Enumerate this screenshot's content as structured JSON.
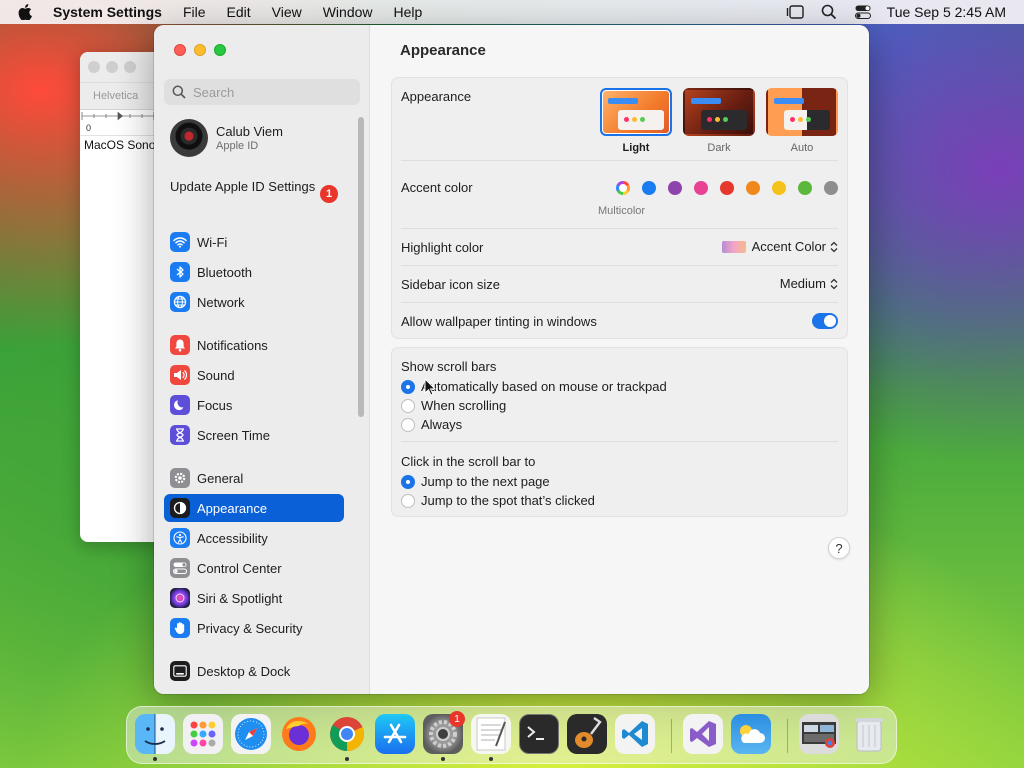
{
  "menubar": {
    "app_name": "System Settings",
    "menus": [
      "File",
      "Edit",
      "View",
      "Window",
      "Help"
    ],
    "clock": "Tue Sep 5  2:45 AM"
  },
  "background_window": {
    "font_name": "Helvetica",
    "ruler_zero": "0",
    "doc_text": "MacOS Sonoma"
  },
  "sidebar": {
    "search_placeholder": "Search",
    "account": {
      "name": "Calub Viem",
      "subtitle": "Apple ID"
    },
    "update": {
      "label": "Update Apple ID Settings",
      "badge": "1"
    },
    "items": [
      {
        "label": "Wi-Fi",
        "icon": "wifi-icon",
        "color": "#1b7cf2"
      },
      {
        "label": "Bluetooth",
        "icon": "bluetooth-icon",
        "color": "#1b7cf2"
      },
      {
        "label": "Network",
        "icon": "globe-icon",
        "color": "#1b7cf2"
      },
      {
        "label": "Notifications",
        "icon": "bell-icon",
        "color": "#f0483e"
      },
      {
        "label": "Sound",
        "icon": "speaker-icon",
        "color": "#f0483e"
      },
      {
        "label": "Focus",
        "icon": "moon-icon",
        "color": "#5d4fd8"
      },
      {
        "label": "Screen Time",
        "icon": "hourglass-icon",
        "color": "#5d4fd8"
      },
      {
        "label": "General",
        "icon": "gear-icon",
        "color": "#8e8e93"
      },
      {
        "label": "Appearance",
        "icon": "appearance-icon",
        "color": "#1d1d1f"
      },
      {
        "label": "Accessibility",
        "icon": "accessibility-icon",
        "color": "#1b7cf2"
      },
      {
        "label": "Control Center",
        "icon": "control-center-icon",
        "color": "#8e8e93"
      },
      {
        "label": "Siri & Spotlight",
        "icon": "siri-icon",
        "color": "#6a3fd0"
      },
      {
        "label": "Privacy & Security",
        "icon": "hand-icon",
        "color": "#1b7cf2"
      },
      {
        "label": "Desktop & Dock",
        "icon": "dock-icon",
        "color": "#1d1d1f"
      }
    ]
  },
  "main": {
    "title": "Appearance",
    "appearance": {
      "label": "Appearance",
      "options": [
        "Light",
        "Dark",
        "Auto"
      ],
      "selected": "Light"
    },
    "accent": {
      "label": "Accent color",
      "selected_name": "Multicolor",
      "colors": [
        "#1a7cf0",
        "#8e44ad",
        "#e84393",
        "#e5372c",
        "#f2871c",
        "#f5c21b",
        "#5cb83a",
        "#8e8e8e"
      ]
    },
    "highlight": {
      "label": "Highlight color",
      "value": "Accent Color"
    },
    "sidebar_icon_size": {
      "label": "Sidebar icon size",
      "value": "Medium"
    },
    "wallpaper_tinting": {
      "label": "Allow wallpaper tinting in windows",
      "on": true
    },
    "scroll_bars": {
      "label": "Show scroll bars",
      "options": [
        "Automatically based on mouse or trackpad",
        "When scrolling",
        "Always"
      ],
      "selected": 0
    },
    "click_scroll": {
      "label": "Click in the scroll bar to",
      "options": [
        "Jump to the next page",
        "Jump to the spot that’s clicked"
      ],
      "selected": 0
    },
    "help": "?"
  },
  "dock": {
    "apps": [
      {
        "name": "finder-icon",
        "running": true
      },
      {
        "name": "launchpad-icon",
        "running": false
      },
      {
        "name": "safari-icon",
        "running": false
      },
      {
        "name": "firefox-icon",
        "running": false
      },
      {
        "name": "chrome-icon",
        "running": true
      },
      {
        "name": "app-store-icon",
        "running": false
      },
      {
        "name": "system-settings-icon",
        "running": true,
        "badge": "1"
      },
      {
        "name": "textedit-icon",
        "running": true
      },
      {
        "name": "terminal-icon",
        "running": false
      },
      {
        "name": "garageband-icon",
        "running": false
      },
      {
        "name": "vscode-icon",
        "running": false
      },
      {
        "name": "visual-studio-icon",
        "running": false
      },
      {
        "name": "weather-icon",
        "running": false
      },
      {
        "name": "window-preview-icon",
        "running": false
      },
      {
        "name": "trash-icon",
        "running": false
      }
    ]
  }
}
